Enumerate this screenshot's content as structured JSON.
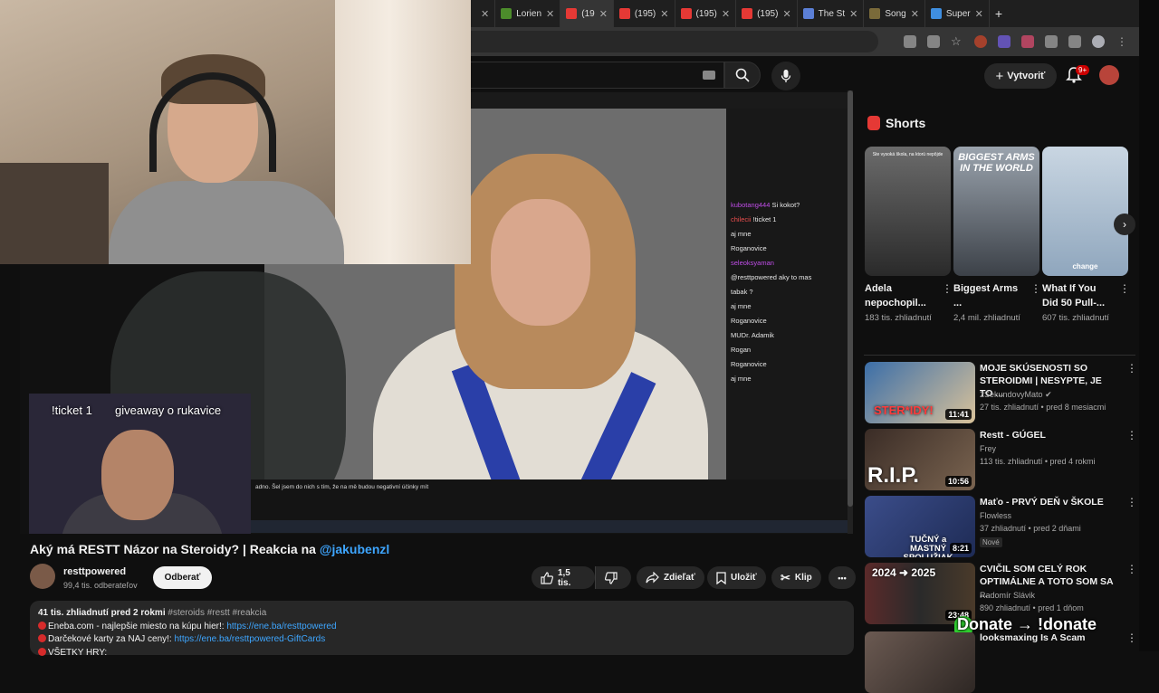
{
  "browser": {
    "tabs": [
      {
        "label": "",
        "color": "#888888"
      },
      {
        "label": "Lorien",
        "color": "#4c8c2b"
      },
      {
        "label": "(19",
        "color": "#e53935",
        "active": true
      },
      {
        "label": "(195)",
        "color": "#e53935"
      },
      {
        "label": "(195)",
        "color": "#e53935"
      },
      {
        "label": "(195)",
        "color": "#e53935"
      },
      {
        "label": "The St",
        "color": "#5b7fd6"
      },
      {
        "label": "Song",
        "color": "#7a6a3a"
      },
      {
        "label": "Super",
        "color": "#3f8ee0"
      }
    ],
    "new_tab": "+"
  },
  "youtube_header": {
    "create_label": "Vytvoriť",
    "notif_count": "9+"
  },
  "stream_overlay": {
    "ticket_text": "!ticket 1",
    "giveaway_text": "giveaway o rukavice",
    "chat": [
      {
        "user": "kubotang444",
        "msg": "Si kokot?"
      },
      {
        "user": "chilecii",
        "msg": "!ticket 1"
      },
      {
        "user": "",
        "msg": "aj mne"
      },
      {
        "user": "",
        "msg": "Roganovice"
      },
      {
        "user": "seleoksyaman",
        "msg": ""
      },
      {
        "user": "",
        "msg": "@resttpowered aky to mas"
      },
      {
        "user": "",
        "msg": "tabak ?"
      },
      {
        "user": "",
        "msg": "aj mne"
      },
      {
        "user": "",
        "msg": "Roganovice"
      },
      {
        "user": "",
        "msg": "MUDr. Adamik"
      },
      {
        "user": "",
        "msg": "Rogan"
      },
      {
        "user": "",
        "msg": "Roganovice"
      },
      {
        "user": "",
        "msg": "aj mne"
      }
    ],
    "subtitle": "adno. Šel jsem do nich s tím, že na mě budou negativní účinky mít"
  },
  "video": {
    "title": "Aký má RESTT Názor na Steroidy? | Reakcia na",
    "mention": "@jakubenzl",
    "channel": "resttpowered",
    "subs": "99,4 tis. odberateľov",
    "subscribe_label": "Odberať",
    "likes": "1,5 tis.",
    "share_label": "Zdieľať",
    "save_label": "Uložiť",
    "clip_label": "Klip",
    "more": "•••"
  },
  "description": {
    "views": "41 tis. zhliadnutí",
    "age": "pred 2 rokmi",
    "tags": "#steroids #restt #reakcia",
    "lines": [
      {
        "text": "Eneba.com - najlepšie miesto na kúpu hier!:",
        "link": "https://ene.ba/resttpowered"
      },
      {
        "text": "Darčekové karty za NAJ ceny!:",
        "link": "https://ene.ba/resttpowered-GiftCards"
      },
      {
        "text": "VŠETKY HRY:",
        "link": ""
      }
    ]
  },
  "shorts": {
    "heading": "Shorts",
    "items": [
      {
        "title": "Adela nepochopil...",
        "views": "183 tis. zhliadnutí",
        "caption": "Ste vysoká škola, na ktorú nepôjde",
        "bg1": "#6b6b6b",
        "bg2": "#2a2a2a"
      },
      {
        "title": "Biggest Arms ...",
        "views": "2,4 mil. zhliadnutí",
        "caption": "BIGGEST ARMS IN THE WORLD",
        "bg1": "#9aa3ad",
        "bg2": "#3c4148"
      },
      {
        "title": "What If You Did 50 Pull-...",
        "views": "607 tis. zhliadnutí",
        "caption": "change",
        "bg1": "#c9d6e2",
        "bg2": "#8fa6bd"
      }
    ]
  },
  "recommended": [
    {
      "title": "MOJE SKÚSENOSTI SO STEROIDMI | NESYPTE, JE TO ...",
      "channel": "2SekundovyMato",
      "verified": true,
      "meta": "27 tis. zhliadnutí • pred 8 mesiacmi",
      "duration": "11:41",
      "thumb_text": "STER*IDY!",
      "bg": "#3b6ea8"
    },
    {
      "title": "Restt - GÚGEL",
      "channel": "Frey",
      "verified": false,
      "meta": "113 tis. zhliadnutí • pred 4 rokmi",
      "duration": "10:56",
      "thumb_text": "R.I.P.",
      "bg": "#3a2c26"
    },
    {
      "title": "Maťo - PRVÝ DEŇ v ŠKOLE",
      "channel": "Flowless",
      "verified": false,
      "meta": "37 zhliadnutí • pred 2 dňami",
      "duration": "8:21",
      "thumb_text": "TUČNÝ a MASTNÝ SPOLUŽIAK",
      "bg": "#3b4d8a",
      "new_badge": "Nové"
    },
    {
      "title": "CVIČIL SOM CELÝ ROK OPTIMÁLNE A TOTO SOM SA ...",
      "channel": "Radomír Slávik",
      "verified": false,
      "meta": "890 zhliadnutí • pred 1 dňom",
      "duration": "23:48",
      "thumb_text": "2024 ➜ 2025",
      "bg": "#5b2a2a"
    },
    {
      "title": "looksmaxing Is A Scam",
      "channel": "",
      "verified": false,
      "meta": "",
      "duration": "",
      "thumb_text": "",
      "bg": "#6b5a52"
    }
  ],
  "donate_overlay": "Donate → !donate"
}
